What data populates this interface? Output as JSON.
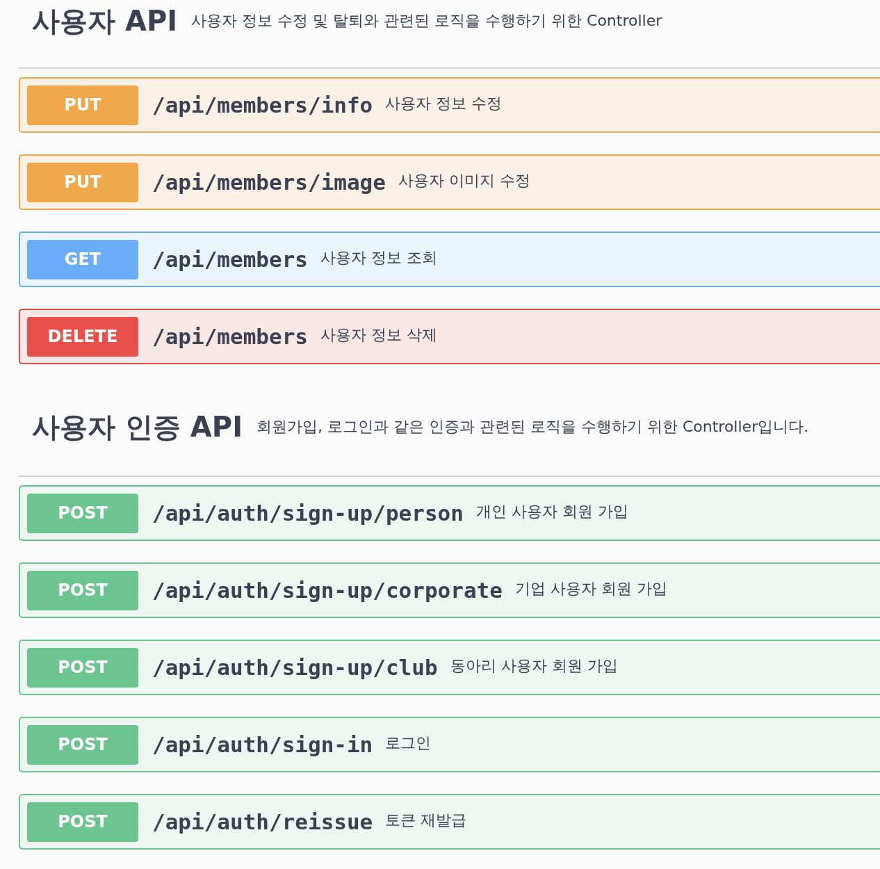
{
  "sections": [
    {
      "title": "사용자 API",
      "description": "사용자 정보 수정 및 탈퇴와 관련된 로직을 수행하기 위한 Controller",
      "operations": [
        {
          "method": "PUT",
          "path": "/api/members/info",
          "summary": "사용자 정보 수정"
        },
        {
          "method": "PUT",
          "path": "/api/members/image",
          "summary": "사용자 이미지 수정"
        },
        {
          "method": "GET",
          "path": "/api/members",
          "summary": "사용자 정보 조회"
        },
        {
          "method": "DELETE",
          "path": "/api/members",
          "summary": "사용자 정보 삭제"
        }
      ]
    },
    {
      "title": "사용자 인증 API",
      "description": "회원가입, 로그인과 같은 인증과 관련된 로직을 수행하기 위한 Controller입니다.",
      "operations": [
        {
          "method": "POST",
          "path": "/api/auth/sign-up/person",
          "summary": "개인 사용자 회원 가입"
        },
        {
          "method": "POST",
          "path": "/api/auth/sign-up/corporate",
          "summary": "기업 사용자 회원 가입"
        },
        {
          "method": "POST",
          "path": "/api/auth/sign-up/club",
          "summary": "동아리 사용자 회원 가입"
        },
        {
          "method": "POST",
          "path": "/api/auth/sign-in",
          "summary": "로그인"
        },
        {
          "method": "POST",
          "path": "/api/auth/reissue",
          "summary": "토큰 재발급"
        }
      ]
    }
  ]
}
